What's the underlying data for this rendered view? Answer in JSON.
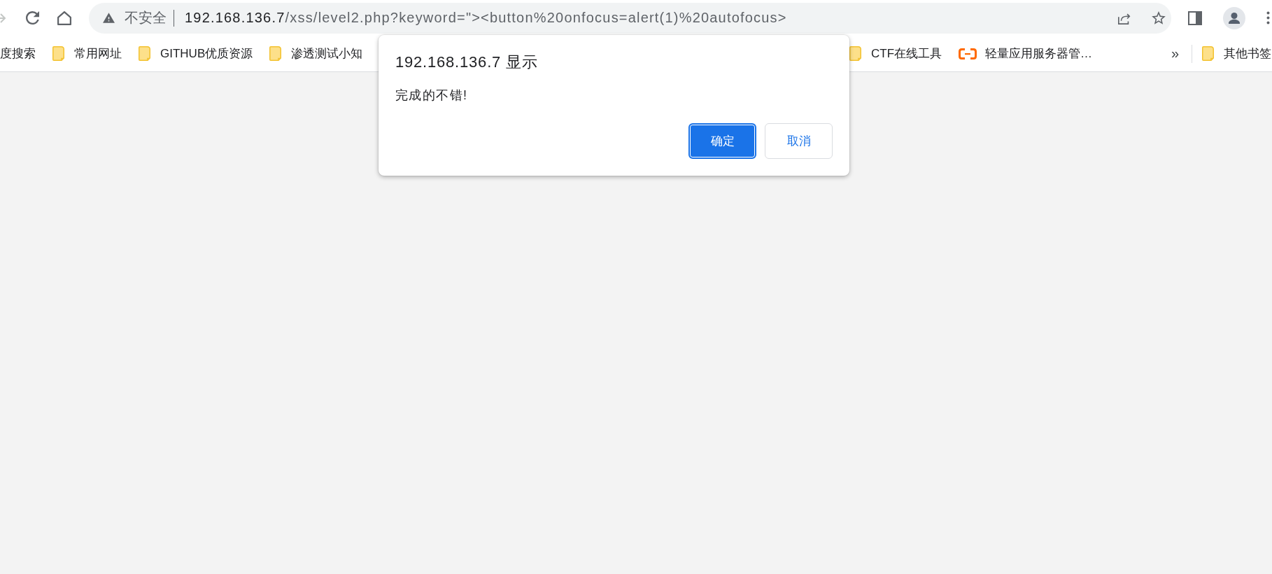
{
  "toolbar": {
    "security_label": "不安全",
    "url_host": "192.168.136.7",
    "url_path": "/xss/level2.php?keyword=\"><button%20onfocus=alert(1)%20autofocus>"
  },
  "bookmarks_bar": {
    "visible_left": [
      {
        "kind": "plain",
        "label": "度搜索"
      },
      {
        "kind": "folder",
        "label": "常用网址"
      },
      {
        "kind": "folder",
        "label": "GITHUB优质资源"
      },
      {
        "kind": "folder",
        "label": "渗透测试小知"
      }
    ],
    "visible_right": [
      {
        "kind": "folder",
        "label": "CTF在线工具"
      },
      {
        "kind": "site",
        "label": "轻量应用服务器管…"
      }
    ],
    "overflow_button": "»",
    "other_bookmarks": {
      "kind": "folder",
      "label": "其他书签"
    }
  },
  "dialog": {
    "title": "192.168.136.7 显示",
    "message": "完成的不错!",
    "buttons": [
      {
        "label": "确定",
        "kind": "primary",
        "focused": true
      },
      {
        "label": "取消",
        "kind": "secondary",
        "focused": false
      }
    ]
  }
}
